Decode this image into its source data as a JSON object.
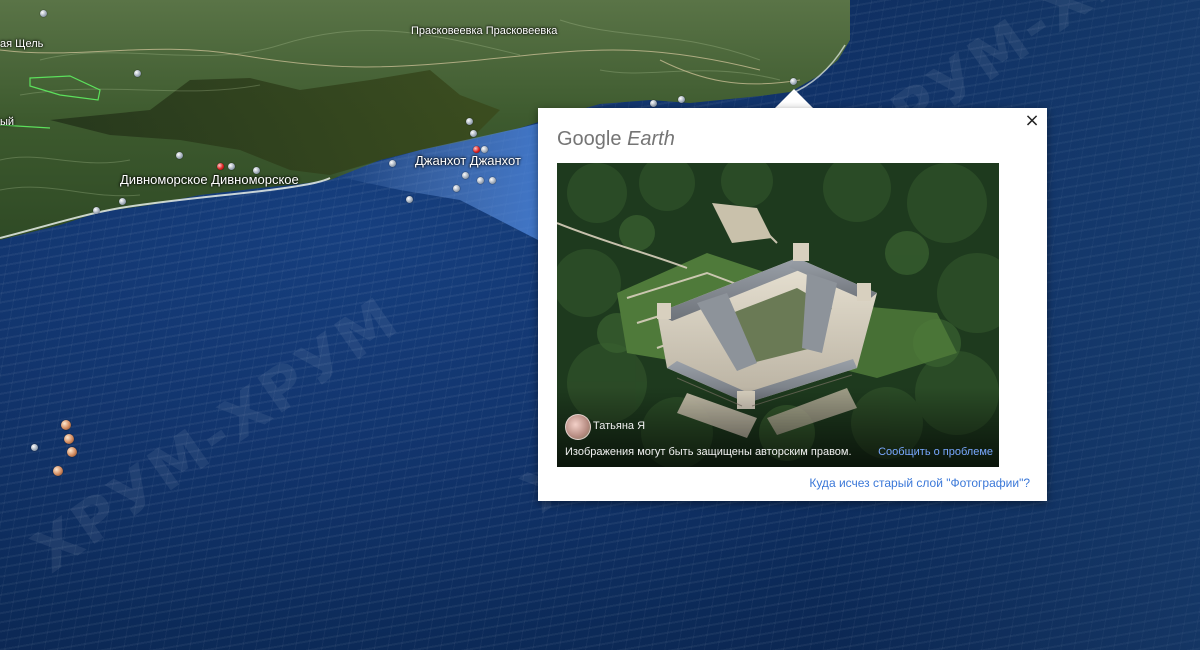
{
  "map": {
    "place_labels": {
      "shchel": "ая Щель",
      "praskoveevka": "Прасковеевка  Прасковеевка",
      "yy": "ый",
      "divnomorskoe": "Дивноморское  Дивноморское",
      "dzhankhot": "Джанхот  Джанхот"
    },
    "watermark_text": "ХРУМ-ХРУМ"
  },
  "popup": {
    "brand_google": "Google",
    "brand_earth": "Earth",
    "close_icon": "×",
    "photo": {
      "author_name": "Татьяна Я",
      "copyright_notice": "Изображения могут быть защищены авторским правом.",
      "report_link": "Сообщить о проблеме"
    },
    "old_layer_link": "Куда исчез старый слой \"Фотографии\"?"
  },
  "colors": {
    "ocean": "#12356e",
    "land": "#3f5a2e",
    "popup_bg": "#ffffff",
    "link": "#3b78d8",
    "report_link": "#79a8ff",
    "brand_gray": "#757575"
  },
  "icons": [
    "close-icon",
    "place-pin-icon",
    "author-avatar"
  ]
}
